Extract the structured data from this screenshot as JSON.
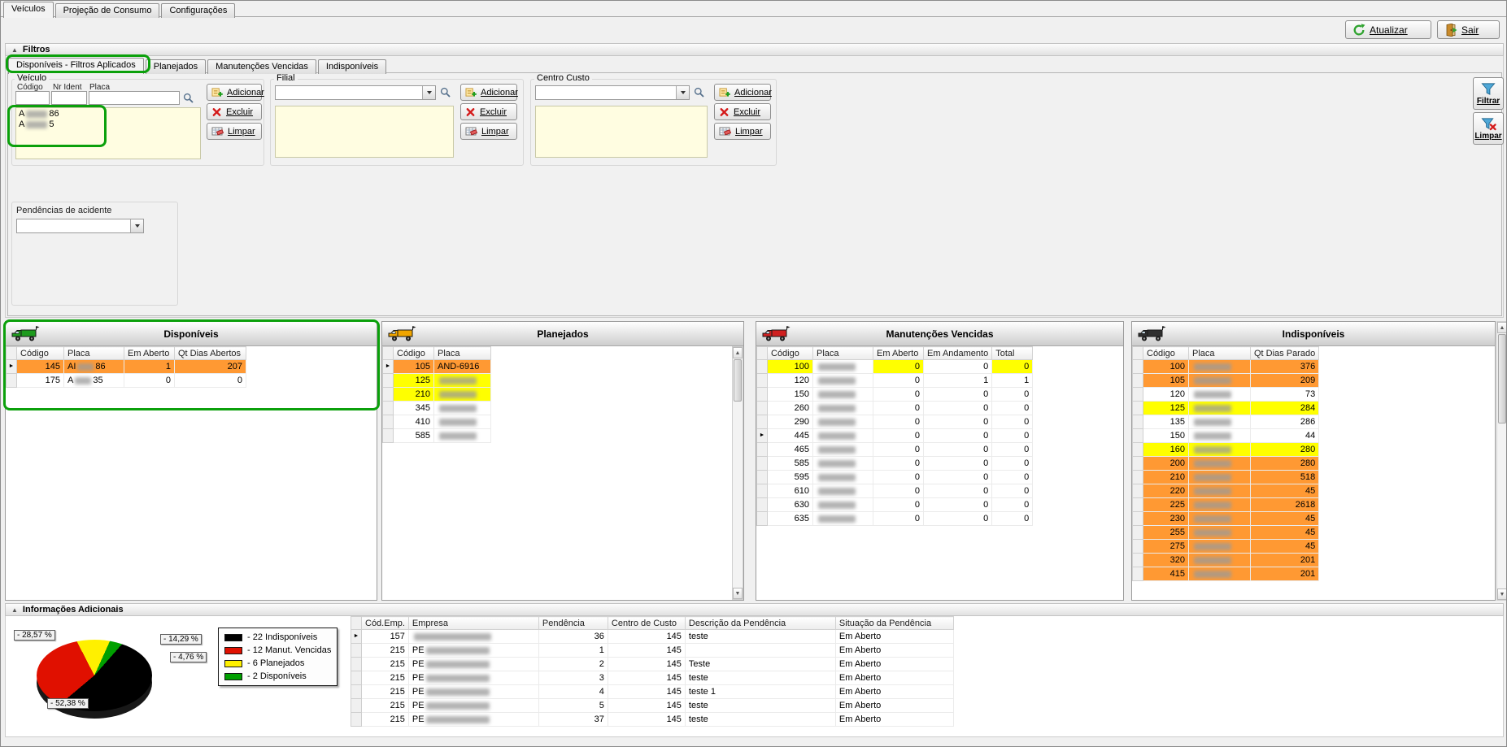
{
  "window": {
    "tabs": [
      "Veículos",
      "Projeção de Consumo",
      "Configurações"
    ],
    "toolbar": {
      "atualizar": "Atualizar",
      "sair": "Sair"
    }
  },
  "filters": {
    "header": "Filtros",
    "tabs": [
      "Disponíveis - Filtros Aplicados",
      "Planejados",
      "Manutenções Vencidas",
      "Indisponíveis"
    ],
    "veiculo": {
      "title": "Veículo",
      "labels": {
        "codigo": "Código",
        "nr_ident": "Nr Ident",
        "placa": "Placa"
      },
      "list": [
        {
          "pre": "A",
          "blur": true,
          "bw": 26,
          "post": "86"
        },
        {
          "pre": "A",
          "blur": true,
          "bw": 26,
          "post": "5"
        }
      ],
      "buttons": {
        "adicionar": "Adicionar",
        "excluir": "Excluir",
        "limpar": "Limpar"
      }
    },
    "filial": {
      "title": "Filial",
      "value": "",
      "buttons": {
        "adicionar": "Adicionar",
        "excluir": "Excluir",
        "limpar": "Limpar"
      },
      "list": []
    },
    "centro_custo": {
      "title": "Centro Custo",
      "value": "",
      "buttons": {
        "adicionar": "Adicionar",
        "excluir": "Excluir",
        "limpar": "Limpar"
      },
      "list": []
    },
    "side": {
      "filtrar": "Filtrar",
      "limpar": "Limpar"
    },
    "pendencias_acidente": {
      "title": "Pendências de acidente",
      "value": ""
    }
  },
  "colors": {
    "o": "#FF9933",
    "y": "#FFFF00"
  },
  "panels": {
    "disponiveis": {
      "title": "Disponíveis",
      "truck_color": "#1E9B1E",
      "columns": [
        "Código",
        "Placa",
        "Em Aberto",
        "Qt Dias Abertos"
      ],
      "marker": 0,
      "rows": [
        [
          {
            "v": "145",
            "bg": "o"
          },
          {
            "pre": "AI",
            "blur": true,
            "bw": 20,
            "post": "86",
            "bg": "o"
          },
          {
            "v": "1",
            "bg": "o"
          },
          {
            "v": "207",
            "bg": "o"
          }
        ],
        [
          {
            "v": "175"
          },
          {
            "pre": "A",
            "blur": true,
            "bw": 20,
            "post": "35"
          },
          {
            "v": "0"
          },
          {
            "v": "0"
          }
        ]
      ]
    },
    "planejados": {
      "title": "Planejados",
      "truck_color": "#F0A500",
      "columns": [
        "Código",
        "Placa"
      ],
      "marker": 0,
      "rows": [
        [
          {
            "v": "105",
            "bg": "o"
          },
          {
            "v": "AND-6916",
            "bg": "o"
          }
        ],
        [
          {
            "v": "125",
            "bg": "y"
          },
          {
            "blur": true,
            "bw": 46,
            "bg": "y"
          }
        ],
        [
          {
            "v": "210",
            "bg": "y"
          },
          {
            "blur": true,
            "bw": 46,
            "bg": "y"
          }
        ],
        [
          {
            "v": "345"
          },
          {
            "blur": true,
            "bw": 46
          }
        ],
        [
          {
            "v": "410"
          },
          {
            "blur": true,
            "bw": 46
          }
        ],
        [
          {
            "v": "585"
          },
          {
            "blur": true,
            "bw": 46
          }
        ]
      ]
    },
    "manutencoes": {
      "title": "Manutenções Vencidas",
      "truck_color": "#D02020",
      "columns": [
        "Código",
        "Placa",
        "Em Aberto",
        "Em Andamento",
        "Total"
      ],
      "marker": 5,
      "rows": [
        [
          {
            "v": "100",
            "bg": "y"
          },
          {
            "blur": true,
            "bw": 46
          },
          {
            "v": "0",
            "bg": "y"
          },
          {
            "v": "0"
          },
          {
            "v": "0",
            "bg": "y"
          }
        ],
        [
          {
            "v": "120"
          },
          {
            "blur": true,
            "bw": 46
          },
          {
            "v": "0"
          },
          {
            "v": "1"
          },
          {
            "v": "1"
          }
        ],
        [
          {
            "v": "150"
          },
          {
            "blur": true,
            "bw": 46
          },
          {
            "v": "0"
          },
          {
            "v": "0"
          },
          {
            "v": "0"
          }
        ],
        [
          {
            "v": "260"
          },
          {
            "blur": true,
            "bw": 46
          },
          {
            "v": "0"
          },
          {
            "v": "0"
          },
          {
            "v": "0"
          }
        ],
        [
          {
            "v": "290"
          },
          {
            "blur": true,
            "bw": 46
          },
          {
            "v": "0"
          },
          {
            "v": "0"
          },
          {
            "v": "0"
          }
        ],
        [
          {
            "v": "445"
          },
          {
            "blur": true,
            "bw": 46
          },
          {
            "v": "0"
          },
          {
            "v": "0"
          },
          {
            "v": "0"
          }
        ],
        [
          {
            "v": "465"
          },
          {
            "blur": true,
            "bw": 46
          },
          {
            "v": "0"
          },
          {
            "v": "0"
          },
          {
            "v": "0"
          }
        ],
        [
          {
            "v": "585"
          },
          {
            "blur": true,
            "bw": 46
          },
          {
            "v": "0"
          },
          {
            "v": "0"
          },
          {
            "v": "0"
          }
        ],
        [
          {
            "v": "595"
          },
          {
            "blur": true,
            "bw": 46
          },
          {
            "v": "0"
          },
          {
            "v": "0"
          },
          {
            "v": "0"
          }
        ],
        [
          {
            "v": "610"
          },
          {
            "blur": true,
            "bw": 46
          },
          {
            "v": "0"
          },
          {
            "v": "0"
          },
          {
            "v": "0"
          }
        ],
        [
          {
            "v": "630"
          },
          {
            "blur": true,
            "bw": 46
          },
          {
            "v": "0"
          },
          {
            "v": "0"
          },
          {
            "v": "0"
          }
        ],
        [
          {
            "v": "635"
          },
          {
            "blur": true,
            "bw": 46
          },
          {
            "v": "0"
          },
          {
            "v": "0"
          },
          {
            "v": "0"
          }
        ]
      ]
    },
    "indisponiveis": {
      "title": "Indisponíveis",
      "truck_color": "#2F2F2F",
      "columns": [
        "Código",
        "Placa",
        "Qt Dias Parado"
      ],
      "rows": [
        [
          {
            "v": "100",
            "bg": "o"
          },
          {
            "blur": true,
            "bw": 46,
            "bg": "o"
          },
          {
            "v": "376",
            "bg": "o"
          }
        ],
        [
          {
            "v": "105",
            "bg": "o"
          },
          {
            "blur": true,
            "bw": 46,
            "bg": "o"
          },
          {
            "v": "209",
            "bg": "o"
          }
        ],
        [
          {
            "v": "120"
          },
          {
            "blur": true,
            "bw": 46
          },
          {
            "v": "73"
          }
        ],
        [
          {
            "v": "125",
            "bg": "y"
          },
          {
            "blur": true,
            "bw": 46,
            "bg": "y"
          },
          {
            "v": "284",
            "bg": "y"
          }
        ],
        [
          {
            "v": "135"
          },
          {
            "blur": true,
            "bw": 46
          },
          {
            "v": "286"
          }
        ],
        [
          {
            "v": "150"
          },
          {
            "blur": true,
            "bw": 46
          },
          {
            "v": "44"
          }
        ],
        [
          {
            "v": "160",
            "bg": "y"
          },
          {
            "blur": true,
            "bw": 46,
            "bg": "y"
          },
          {
            "v": "280",
            "bg": "y"
          }
        ],
        [
          {
            "v": "200",
            "bg": "o"
          },
          {
            "blur": true,
            "bw": 46,
            "bg": "o"
          },
          {
            "v": "280",
            "bg": "o"
          }
        ],
        [
          {
            "v": "210",
            "bg": "o"
          },
          {
            "blur": true,
            "bw": 46,
            "bg": "o"
          },
          {
            "v": "518",
            "bg": "o"
          }
        ],
        [
          {
            "v": "220",
            "bg": "o"
          },
          {
            "blur": true,
            "bw": 46,
            "bg": "o"
          },
          {
            "v": "45",
            "bg": "o"
          }
        ],
        [
          {
            "v": "225",
            "bg": "o"
          },
          {
            "blur": true,
            "bw": 46,
            "bg": "o"
          },
          {
            "v": "2618",
            "bg": "o"
          }
        ],
        [
          {
            "v": "230",
            "bg": "o"
          },
          {
            "blur": true,
            "bw": 46,
            "bg": "o"
          },
          {
            "v": "45",
            "bg": "o"
          }
        ],
        [
          {
            "v": "255",
            "bg": "o"
          },
          {
            "blur": true,
            "bw": 46,
            "bg": "o"
          },
          {
            "v": "45",
            "bg": "o"
          }
        ],
        [
          {
            "v": "275",
            "bg": "o"
          },
          {
            "blur": true,
            "bw": 46,
            "bg": "o"
          },
          {
            "v": "45",
            "bg": "o"
          }
        ],
        [
          {
            "v": "320",
            "bg": "o"
          },
          {
            "blur": true,
            "bw": 46,
            "bg": "o"
          },
          {
            "v": "201",
            "bg": "o"
          }
        ],
        [
          {
            "v": "415",
            "bg": "o"
          },
          {
            "blur": true,
            "bw": 46,
            "bg": "o"
          },
          {
            "v": "201",
            "bg": "o"
          }
        ]
      ]
    }
  },
  "info": {
    "header": "Informações Adicionais",
    "pie": {
      "slices": [
        {
          "label": "Manut. Vencidas",
          "value": 12,
          "pct": 28.57,
          "color": "#E01000"
        },
        {
          "label": "Planejados",
          "value": 6,
          "pct": 14.29,
          "color": "#FFF000"
        },
        {
          "label": "Disponíveis",
          "value": 2,
          "pct": 4.76,
          "color": "#00A000"
        },
        {
          "label": "Indisponíveis",
          "value": 22,
          "pct": 52.38,
          "color": "#000000"
        }
      ],
      "callouts": [
        "- 28,57 %",
        "- 14,29 %",
        "- 4,76 %",
        "- 52,38 %"
      ],
      "legend": [
        {
          "color": "#000000",
          "label": "- 22 Indisponíveis"
        },
        {
          "color": "#E01000",
          "label": "- 12 Manut. Vencidas"
        },
        {
          "color": "#FFF000",
          "label": "- 6 Planejados"
        },
        {
          "color": "#00A000",
          "label": "- 2 Disponíveis"
        }
      ]
    },
    "table": {
      "columns": [
        "Cód.Emp.",
        "Empresa",
        "Pendência",
        "Centro de Custo",
        "Descrição da Pendência",
        "Situação da Pendência"
      ],
      "marker": 0,
      "rows": [
        [
          {
            "v": "157"
          },
          {
            "blur": true,
            "bw": 95
          },
          {
            "v": "36"
          },
          {
            "v": "145"
          },
          {
            "v": "teste"
          },
          {
            "v": "Em Aberto"
          }
        ],
        [
          {
            "v": "215"
          },
          {
            "pre": "PE",
            "blur": true,
            "bw": 78
          },
          {
            "v": "1"
          },
          {
            "v": "145"
          },
          {
            "v": ""
          },
          {
            "v": "Em Aberto"
          }
        ],
        [
          {
            "v": "215"
          },
          {
            "pre": "PE",
            "blur": true,
            "bw": 78
          },
          {
            "v": "2"
          },
          {
            "v": "145"
          },
          {
            "v": "Teste"
          },
          {
            "v": "Em Aberto"
          }
        ],
        [
          {
            "v": "215"
          },
          {
            "pre": "PE",
            "blur": true,
            "bw": 78
          },
          {
            "v": "3"
          },
          {
            "v": "145"
          },
          {
            "v": "teste"
          },
          {
            "v": "Em Aberto"
          }
        ],
        [
          {
            "v": "215"
          },
          {
            "pre": "PE",
            "blur": true,
            "bw": 78
          },
          {
            "v": "4"
          },
          {
            "v": "145"
          },
          {
            "v": "teste 1"
          },
          {
            "v": "Em Aberto"
          }
        ],
        [
          {
            "v": "215"
          },
          {
            "pre": "PE",
            "blur": true,
            "bw": 78
          },
          {
            "v": "5"
          },
          {
            "v": "145"
          },
          {
            "v": "teste"
          },
          {
            "v": "Em Aberto"
          }
        ],
        [
          {
            "v": "215"
          },
          {
            "pre": "PE",
            "blur": true,
            "bw": 78
          },
          {
            "v": "37"
          },
          {
            "v": "145"
          },
          {
            "v": "teste"
          },
          {
            "v": "Em Aberto"
          }
        ]
      ]
    }
  },
  "chart_data": {
    "type": "pie",
    "labels": [
      "Indisponíveis",
      "Manut. Vencidas",
      "Planejados",
      "Disponíveis"
    ],
    "values": [
      22,
      12,
      6,
      2
    ],
    "percentages": [
      52.38,
      28.57,
      14.29,
      4.76
    ],
    "colors": [
      "#000000",
      "#E01000",
      "#FFF000",
      "#00A000"
    ],
    "legend_position": "right"
  }
}
